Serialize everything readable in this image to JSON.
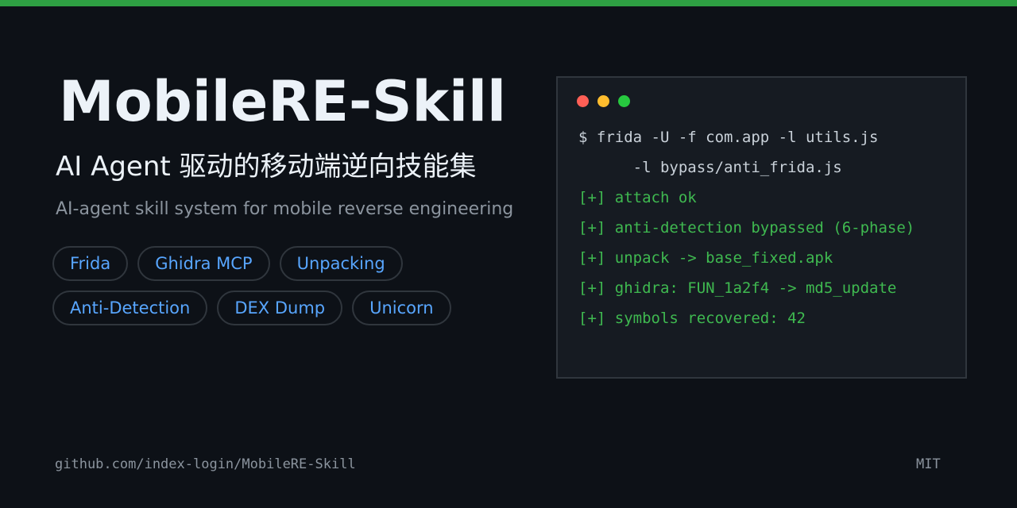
{
  "header": {
    "title": "MobileRE-Skill",
    "subtitle_cn": "AI Agent 驱动的移动端逆向技能集",
    "subtitle_en": "AI-agent skill system for mobile reverse engineering"
  },
  "tags": {
    "row1": [
      "Frida",
      "Ghidra MCP",
      "Unpacking"
    ],
    "row2": [
      "Anti-Detection",
      "DEX Dump",
      "Unicorn"
    ]
  },
  "terminal": {
    "dot_colors": [
      "#ff5f56",
      "#ffbd2e",
      "#27c93f"
    ],
    "lines": [
      {
        "text": "$ frida -U -f com.app -l utils.js",
        "color": "#c9d1d9"
      },
      {
        "text": "      -l bypass/anti_frida.js",
        "color": "#c9d1d9"
      },
      {
        "text": "[+] attach ok",
        "color": "#3fb950"
      },
      {
        "text": "[+] anti-detection bypassed (6-phase)",
        "color": "#3fb950"
      },
      {
        "text": "[+] unpack -> base_fixed.apk",
        "color": "#3fb950"
      },
      {
        "text": "[+] ghidra: FUN_1a2f4 -> md5_update",
        "color": "#3fb950"
      },
      {
        "text": "[+] symbols recovered: 42",
        "color": "#3fb950"
      }
    ]
  },
  "footer": {
    "repo": "github.com/index-login/MobileRE-Skill",
    "license": "MIT"
  },
  "colors": {
    "background": "#0d1117",
    "accent_bar": "#2ea043",
    "tag_text": "#58a6ff",
    "border": "#30363d"
  }
}
